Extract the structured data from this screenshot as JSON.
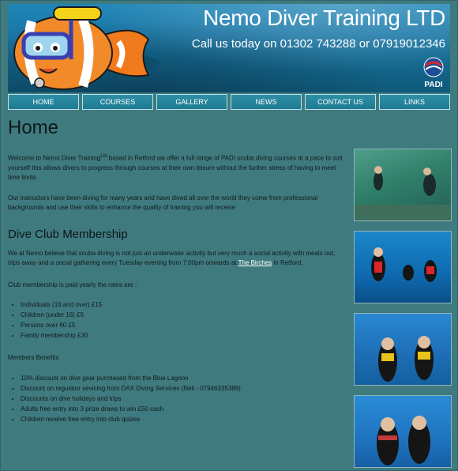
{
  "header": {
    "title": "Nemo Diver Training LTD",
    "phone": "Call us today on 01302 743288 or 07919012346",
    "badge": "PADI"
  },
  "nav": {
    "items": [
      {
        "label": "HOME"
      },
      {
        "label": "COURSES"
      },
      {
        "label": "GALLERY"
      },
      {
        "label": "NEWS"
      },
      {
        "label": "CONTACT US"
      },
      {
        "label": "LINKS"
      }
    ]
  },
  "main": {
    "heading": "Home",
    "intro_before": "Welcome to Nemo Diver Training",
    "intro_sup": "Ltd",
    "intro_after": " based in Retford we offer a full range of PADI scuba diving courses at a pace to suit yourself this allows divers to progress through courses at their own leisure without the further stress of having to meet time limits.",
    "instructors": "Our instructors have been diving for many years and have dived all over the world they come from professional backgrounds and use their skills to enhance the quality of training you will receive",
    "club_heading": "Dive Club Membership",
    "club_text_before": "We at Nemo believe that scuba diving is not just an underwater activity but very much a social activity with meals out, trips away and a social gathering every Tuesday evening from 7:00pm onwards at ",
    "club_link": "The Birches",
    "club_text_after": " in Retford.",
    "rates_intro": "Club membership is paid yearly the rates are :",
    "rates": [
      "Individuals (16 and over) £15",
      "Children (under 16) £5",
      "Persons over 60 £5",
      "Family membership £30"
    ],
    "benefits_intro": "Members Benefits",
    "benefits": [
      "10% discount on dive gear purchased from the Blue Lagoon",
      "Discount on regulator sevicing from DAX Diving Services (Neil - 07946335389)",
      "Discounts on dive holidays and trips",
      "Adults free entry into 3 prize draws to win £50 cash",
      "Children receive free entry into club quizes"
    ]
  },
  "colors": {
    "page_bg": "#3f7a7f",
    "banner": "#1a77a6",
    "nav_bg": "#1f7a90"
  }
}
